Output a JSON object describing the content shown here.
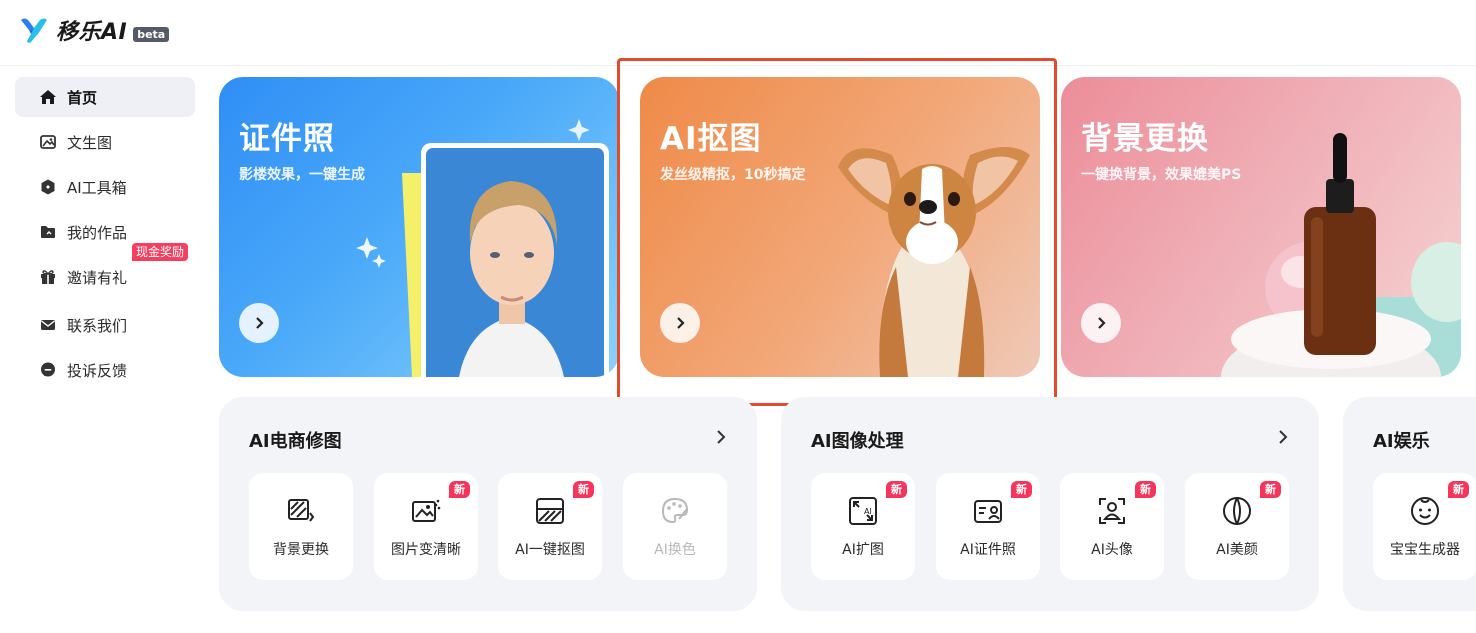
{
  "header": {
    "logo_text": "移乐AI",
    "logo_badge": "beta"
  },
  "sidebar": {
    "items": [
      {
        "label": "首页",
        "icon": "home-icon",
        "active": true
      },
      {
        "label": "文生图",
        "icon": "image-icon"
      },
      {
        "label": "AI工具箱",
        "icon": "toolbox-icon"
      },
      {
        "label": "我的作品",
        "icon": "folder-icon"
      },
      {
        "label": "邀请有礼",
        "icon": "gift-icon",
        "badge": "现金奖励"
      },
      {
        "label": "联系我们",
        "icon": "mail-icon"
      },
      {
        "label": "投诉反馈",
        "icon": "chat-icon"
      }
    ]
  },
  "banners": [
    {
      "title": "证件照",
      "subtitle": "影楼效果，一键生成"
    },
    {
      "title": "AI抠图",
      "subtitle": "发丝级精抠，10秒搞定"
    },
    {
      "title": "背景更换",
      "subtitle": "一键换背景，效果媲美PS"
    }
  ],
  "panels": [
    {
      "title": "AI电商修图",
      "tools": [
        {
          "label": "背景更换",
          "icon": "background-replace-icon",
          "badge": ""
        },
        {
          "label": "图片变清晰",
          "icon": "sharpen-image-icon",
          "badge": "新"
        },
        {
          "label": "AI一键抠图",
          "icon": "cutout-icon",
          "badge": "新"
        },
        {
          "label": "AI换色",
          "icon": "palette-icon",
          "badge": ""
        }
      ]
    },
    {
      "title": "AI图像处理",
      "tools": [
        {
          "label": "AI扩图",
          "icon": "expand-image-icon",
          "badge": "新"
        },
        {
          "label": "AI证件照",
          "icon": "id-card-icon",
          "badge": "新"
        },
        {
          "label": "AI头像",
          "icon": "avatar-scan-icon",
          "badge": "新"
        },
        {
          "label": "AI美颜",
          "icon": "beauty-icon",
          "badge": "新"
        }
      ]
    },
    {
      "title": "AI娱乐",
      "tools": [
        {
          "label": "宝宝生成器",
          "icon": "baby-face-icon",
          "badge": "新"
        }
      ]
    }
  ],
  "colors": {
    "accent": "#2f8ef5",
    "badge": "#f5365c",
    "highlight": "#e24b2e"
  }
}
